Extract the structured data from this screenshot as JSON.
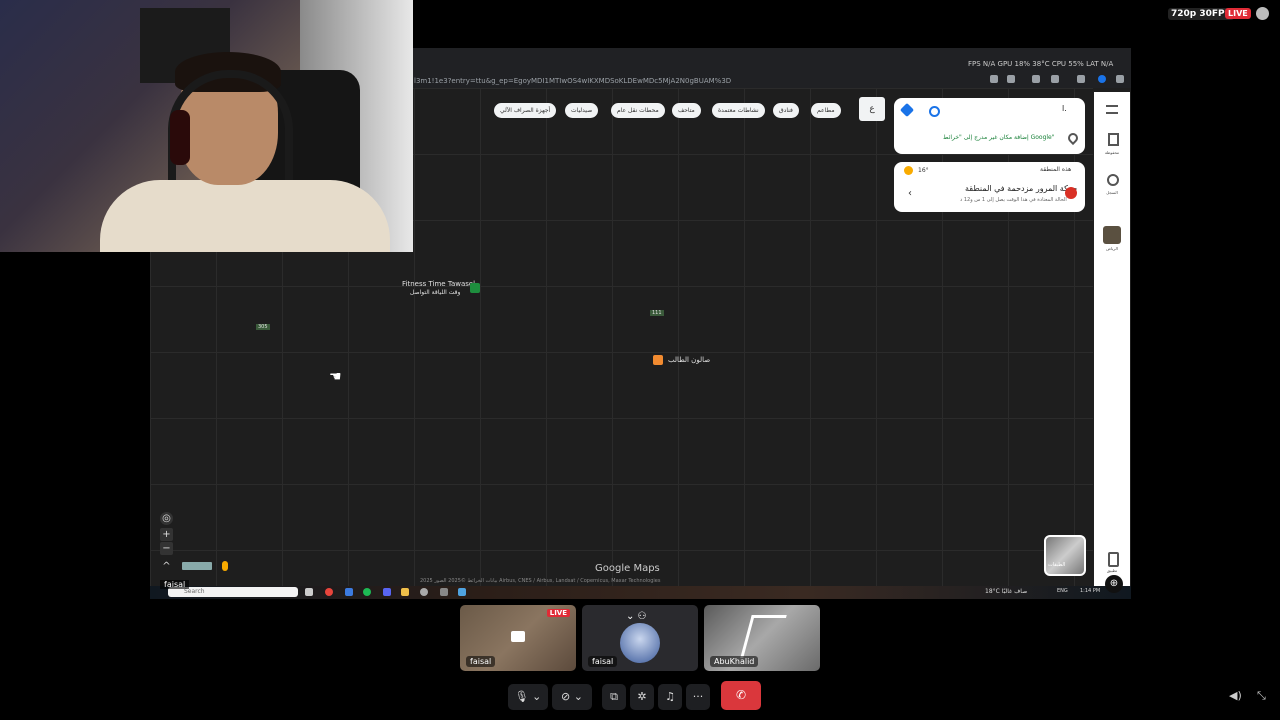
{
  "stream": {
    "quality": "720p 30FPS",
    "live": "LIVE"
  },
  "browser": {
    "url": "l3m1!1e3?entry=ttu&g_ep=EgoyMDI1MTIwOS4wIKXMDSoKLDEwMDc5MjA2N0gBUAM%3D",
    "stats": "FPS N/A GPU 18% 38°C CPU 55% LAT N/A"
  },
  "map": {
    "chips": [
      "مطاعم",
      "فنادق",
      "نشاطات معتمدة",
      "متاحف",
      "محطات نقل عام",
      "صيدليات",
      "أجهزة الصراف الآلي"
    ],
    "more_chip": "ع",
    "search_value": "ا.",
    "add_missing_place": "إضافة مكان غير مدرج إلى \"خرائط Google\"",
    "area_title": "هذه المنطقة",
    "weather": "16°",
    "area_headline": "حركة المرور مزدحمة في المنطقة",
    "area_sub": "الحالة المعتادة في هذا الوقت يصل إلى 1 س و12 د",
    "labels": {
      "place1": "Fitness Time Tawasol",
      "place1_ar": "وقت اللياقة التواصل",
      "place2": "صالون الطالب",
      "small1": "305",
      "small2": "111"
    },
    "logo": "Google Maps",
    "attribution": "2025 بيانات الخرائط ©2025 الصور Airbus, CNES / Airbus, Landsat / Copernicus, Maxar Technologies",
    "layers_label": "الطبقات",
    "rail": [
      "القائمة",
      "محفوظة",
      "السجل",
      "الرياض",
      "تطبيق"
    ]
  },
  "taskbar": {
    "search_placeholder": "Search",
    "weather": "18°C صاف غالبًا",
    "lang": "ENG",
    "time": "1:14 PM"
  },
  "call": {
    "screen_sharer": "faisal",
    "tiles": [
      {
        "name": "faisal",
        "badge": "LIVE"
      },
      {
        "name": "faisal"
      },
      {
        "name": "AbuKhalid"
      }
    ]
  }
}
